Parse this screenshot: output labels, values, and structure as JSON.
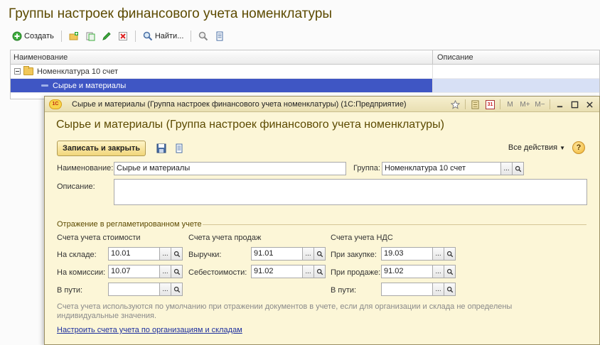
{
  "main": {
    "title": "Группы настроек финансового учета номенклатуры",
    "toolbar": {
      "create_label": "Создать",
      "find_label": "Найти..."
    },
    "list": {
      "columns": [
        "Наименование",
        "Описание"
      ],
      "rows": [
        {
          "name": "Номенклатура 10 счет",
          "type": "folder",
          "expanded": true
        },
        {
          "name": "Сырье и материалы",
          "type": "element",
          "selected": true
        }
      ]
    }
  },
  "modal": {
    "caption": "Сырье и материалы (Группа настроек финансового учета номенклатуры)  (1С:Предприятие)",
    "logo": "1С",
    "title": "Сырье и материалы (Группа настроек финансового учета номенклатуры)",
    "save_close_label": "Записать и закрыть",
    "all_actions_label": "Все действия",
    "help_label": "?",
    "win_controls": {
      "m": "M",
      "m_plus": "M+",
      "m_minus": "M−",
      "calendar": "31"
    },
    "name_label": "Наименование:",
    "name_value": "Сырье и материалы",
    "group_label": "Группа:",
    "group_value": "Номенклатура 10 счет",
    "description_label": "Описание:",
    "description_value": "",
    "section_title": "Отражение в регламетированном учете",
    "cost": {
      "title": "Счета учета стоимости",
      "warehouse_label": "На складе:",
      "warehouse_value": "10.01",
      "commission_label": "На комиссии:",
      "commission_value": "10.07",
      "transit_label": "В пути:",
      "transit_value": ""
    },
    "sales": {
      "title": "Счета учета продаж",
      "revenue_label": "Выручки:",
      "revenue_value": "91.01",
      "cost_label": "Себестоимости:",
      "cost_value": "91.02"
    },
    "vat": {
      "title": "Счета учета НДС",
      "purchase_label": "При закупке:",
      "purchase_value": "19.03",
      "sale_label": "При продаже:",
      "sale_value": "91.02",
      "transit_label": "В пути:",
      "transit_value": ""
    },
    "note": "Счета учета используются по умолчанию при отражении документов в учете, если для организации и склада не определены индивидуальные значения.",
    "link_label": "Настроить счета учета по организациям и складам"
  }
}
